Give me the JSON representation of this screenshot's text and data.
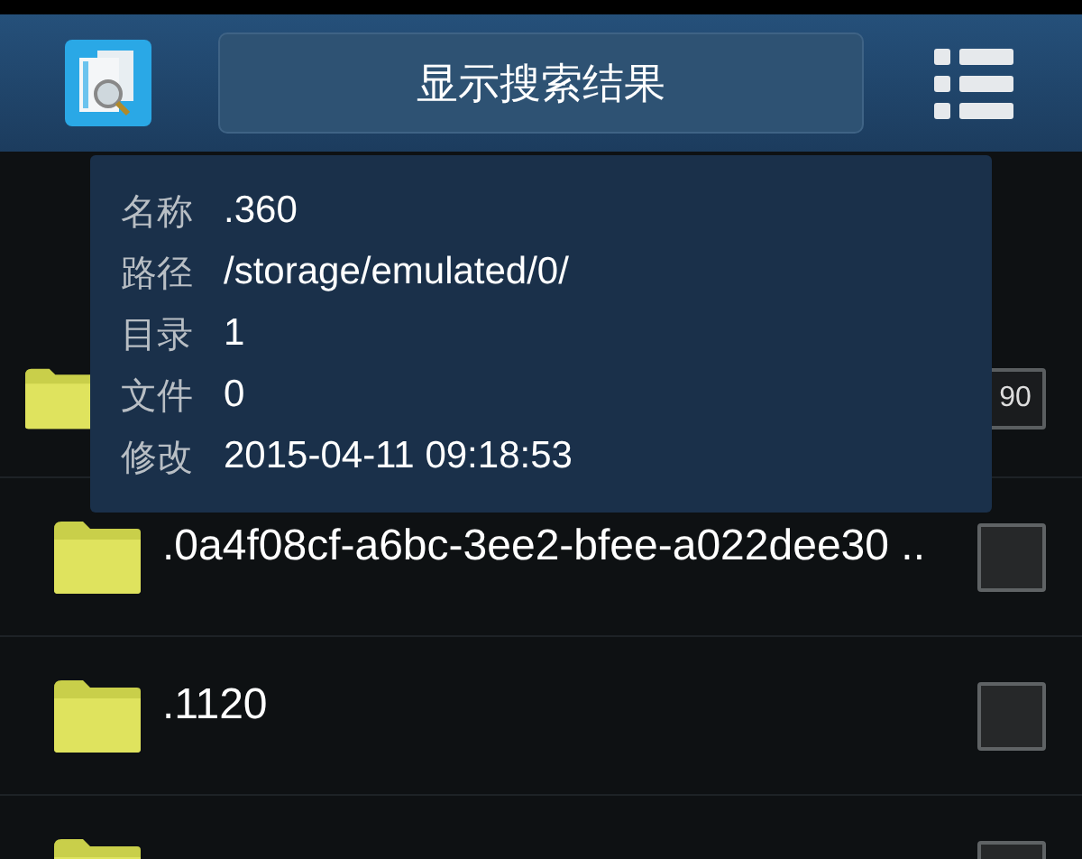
{
  "header": {
    "title": "显示搜索结果"
  },
  "popup": {
    "fields": [
      {
        "label": "名称",
        "value": ".360"
      },
      {
        "label": "路径",
        "value": "/storage/emulated/0/"
      },
      {
        "label": "目录",
        "value": "1"
      },
      {
        "label": "文件",
        "value": "0"
      },
      {
        "label": "修改",
        "value": "2015-04-11 09:18:53"
      }
    ]
  },
  "list": {
    "rows": [
      {
        "kind": "parent",
        "badge": "90"
      },
      {
        "kind": "folder",
        "name": ".0a4f08cf-a6bc-3ee2-bfee-a022dee30 ..",
        "checked": false
      },
      {
        "kind": "folder",
        "name": ".1120",
        "checked": false
      },
      {
        "kind": "folder",
        "checked": false
      }
    ]
  }
}
